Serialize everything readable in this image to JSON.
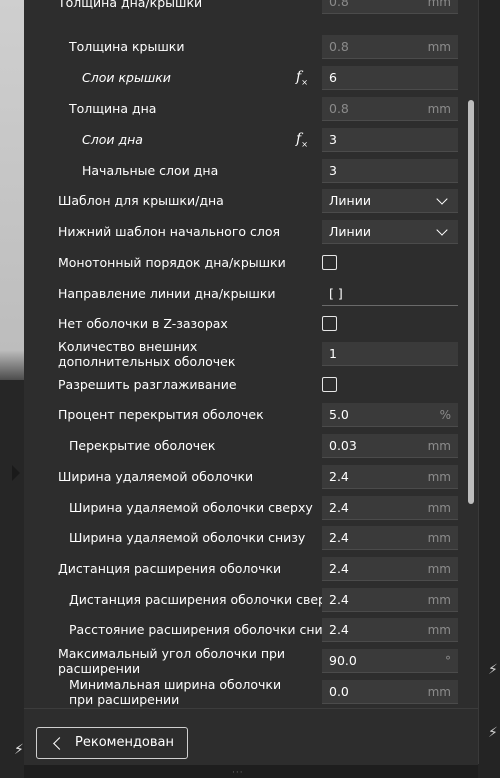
{
  "settings": {
    "top_partial": {
      "label": "Толщина дна/крышки",
      "value": "0.8",
      "unit": "mm"
    },
    "rows": [
      {
        "label": "Толщина крышки",
        "value": "0.8",
        "unit": "mm"
      },
      {
        "label": "Слои крышки",
        "value": "6",
        "fx": "f"
      },
      {
        "label": "Толщина дна",
        "value": "0.8",
        "unit": "mm"
      },
      {
        "label": "Слои дна",
        "value": "3",
        "fx": "f"
      },
      {
        "label": "Начальные слои дна",
        "value": "3"
      },
      {
        "label": "Шаблон для крышки/дна",
        "value": "Линии"
      },
      {
        "label": "Нижний шаблон начального слоя",
        "value": "Линии"
      },
      {
        "label": "Монотонный порядок дна/крышки",
        "checked": false
      },
      {
        "label": "Направление линии дна/крышки",
        "value": "[ ]"
      },
      {
        "label": "Нет оболочки в Z-зазорах",
        "checked": false
      },
      {
        "label": "Количество внешних дополнительных оболочек",
        "value": "1"
      },
      {
        "label": "Разрешить разглаживание",
        "checked": false
      },
      {
        "label": "Процент перекрытия оболочек",
        "value": "5.0",
        "unit": "%"
      },
      {
        "label": "Перекрытие оболочек",
        "value": "0.03",
        "unit": "mm"
      },
      {
        "label": "Ширина удаляемой оболочки",
        "value": "2.4",
        "unit": "mm"
      },
      {
        "label": "Ширина удаляемой оболочки сверху",
        "value": "2.4",
        "unit": "mm"
      },
      {
        "label": "Ширина удаляемой оболочки снизу",
        "value": "2.4",
        "unit": "mm"
      },
      {
        "label": "Дистанция расширения оболочки",
        "value": "2.4",
        "unit": "mm"
      },
      {
        "label": "Дистанция расширения оболочки сверху",
        "value": "2.4",
        "unit": "mm"
      },
      {
        "label": "Расстояние расширения оболочки снизу",
        "value": "2.4",
        "unit": "mm"
      },
      {
        "label": "Максимальный угол оболочки при расширении",
        "value": "90.0",
        "unit": "°"
      },
      {
        "label": "Минимальная ширина оболочки при расширении",
        "value": "0.0",
        "unit": "mm"
      }
    ]
  },
  "footer": {
    "recommended_label": "Рекомендован"
  },
  "colors": {
    "panel": "#2d2d2d",
    "field": "#3a3a3a",
    "text": "#ffffff",
    "unit": "#8c8c8c"
  }
}
